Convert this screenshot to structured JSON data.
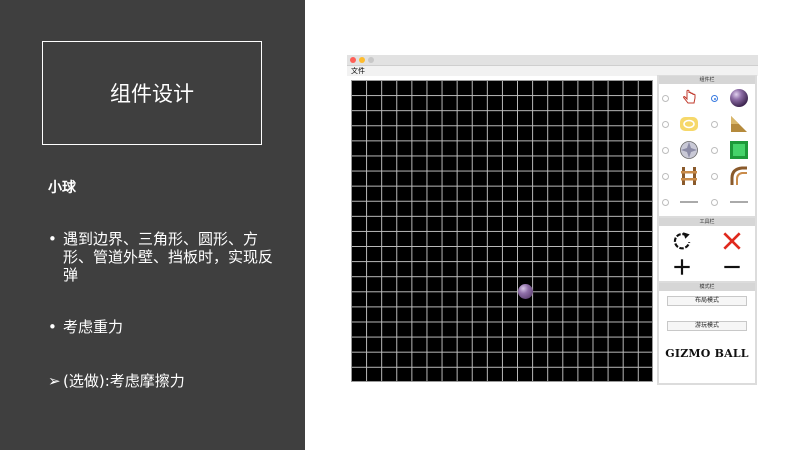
{
  "slide": {
    "title": "组件设计",
    "subtitle": "小球",
    "bullets": [
      {
        "mark": "•",
        "text": "遇到边界、三角形、圆形、方形、管道外壁、挡板时，实现反弹"
      },
      {
        "mark": "•",
        "text": "考虑重力"
      },
      {
        "mark": "➢",
        "text": "(选做):考虑摩擦力"
      }
    ]
  },
  "app": {
    "window_buttons": [
      "#ff5f57",
      "#febc2e",
      "#c8c8c8"
    ],
    "menu_file": "文件",
    "component_panel": {
      "title": "组件栏",
      "items": [
        {
          "left_icon": "hand-cursor-icon",
          "right_icon": "ball-icon",
          "selected": "right"
        },
        {
          "left_icon": "circle-icon",
          "right_icon": "triangle-icon"
        },
        {
          "left_icon": "absorber-icon",
          "right_icon": "square-icon"
        },
        {
          "left_icon": "track-icon",
          "right_icon": "curved-track-icon"
        },
        {
          "left_icon": "left-flipper-icon",
          "right_icon": "right-flipper-icon"
        }
      ]
    },
    "tool_panel": {
      "title": "工具栏",
      "tools": [
        "rotate-icon",
        "delete-icon",
        "zoom-in-icon",
        "zoom-out-icon"
      ]
    },
    "mode_panel": {
      "title": "模式栏",
      "layout_mode": "布局模式",
      "play_mode": "游玩模式",
      "brand": "GIZMO BALL"
    },
    "colors": {
      "accent_red": "#e0291d",
      "ball": "#7a5a92"
    }
  }
}
